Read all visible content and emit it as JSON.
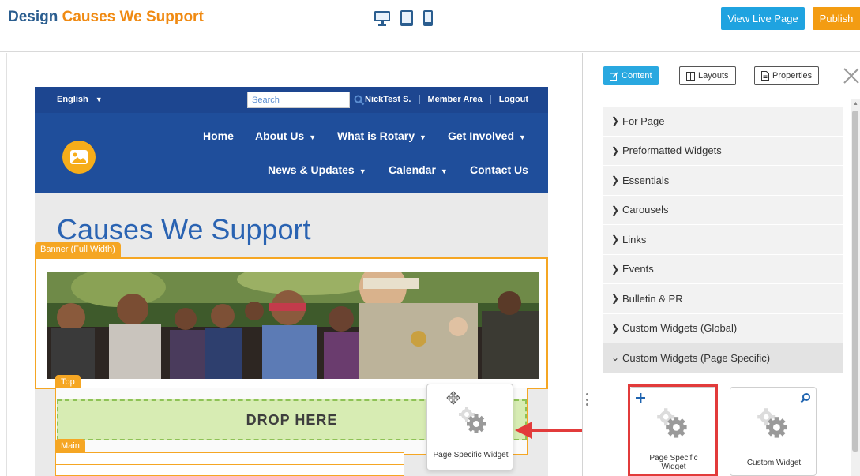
{
  "header": {
    "title_prefix": "Design",
    "title_accent": "Causes We Support",
    "devices": [
      "desktop-icon",
      "tablet-icon",
      "phone-icon"
    ],
    "view_live_label": "View Live Page",
    "publish_label": "Publish"
  },
  "site": {
    "language": "English",
    "search_placeholder": "Search",
    "util_links": [
      "NickTest S.",
      "Member Area",
      "Logout"
    ],
    "nav_row1": [
      "Home",
      "About Us",
      "What is Rotary",
      "Get Involved"
    ],
    "nav_row2": [
      "News & Updates",
      "Calendar",
      "Contact Us"
    ],
    "page_heading": "Causes We Support"
  },
  "regions": {
    "banner_tag": "Banner (Full Width)",
    "top_tag": "Top",
    "drop_label": "DROP HERE",
    "main_tag": "Main"
  },
  "drag": {
    "label": "Page Specific Widget"
  },
  "panel": {
    "tabs": [
      {
        "label": "Content",
        "active": true
      },
      {
        "label": "Layouts",
        "active": false
      },
      {
        "label": "Properties",
        "active": false
      }
    ],
    "sections": [
      {
        "label": "For Page",
        "open": false
      },
      {
        "label": "Preformatted Widgets",
        "open": false
      },
      {
        "label": "Essentials",
        "open": false
      },
      {
        "label": "Carousels",
        "open": false
      },
      {
        "label": "Links",
        "open": false
      },
      {
        "label": "Events",
        "open": false
      },
      {
        "label": "Bulletin & PR",
        "open": false
      },
      {
        "label": "Custom Widgets (Global)",
        "open": false
      },
      {
        "label": "Custom Widgets (Page Specific)",
        "open": true
      }
    ],
    "widgets": [
      {
        "label_line1": "Page Specific",
        "label_line2": "Widget",
        "icon": "plus-icon"
      },
      {
        "label_line1": "Custom Widget",
        "label_line2": "",
        "icon": "search-icon"
      }
    ]
  },
  "colors": {
    "brand_blue": "#1f4e9b",
    "accent_orange": "#f08a12",
    "live_button": "#1fa3e0",
    "publish_button": "#f39c12",
    "region_tag": "#f5a623",
    "drop_zone": "#d7ecb3",
    "highlight": "#e23b3b"
  }
}
